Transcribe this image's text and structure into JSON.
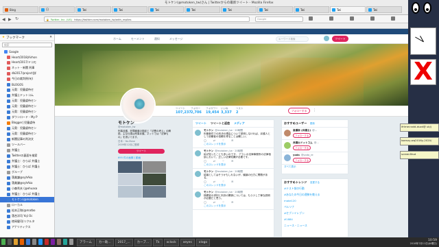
{
  "window": {
    "title": "モトケン(@motoken_tw)さん | Twitterからの最新ツイート - Mozilla Firefox"
  },
  "tabs": [
    {
      "label": "Bing"
    },
    {
      "label": "日"
    },
    {
      "label": "Twi"
    },
    {
      "label": "Twi"
    },
    {
      "label": "Twi"
    },
    {
      "label": "Twi"
    },
    {
      "label": "Twi"
    },
    {
      "label": "Twi"
    },
    {
      "label": "Twi"
    },
    {
      "label": "Twi"
    },
    {
      "label": "Twi"
    }
  ],
  "url": {
    "site": "Twitter, Inc. (US)",
    "address": "https://twitter.com/motoken_tw/with_replies",
    "search_placeholder": "Google"
  },
  "sidebar": {
    "title": "ブックマーク",
    "search_placeholder": "検索",
    "items": [
      {
        "label": "Google",
        "color": "#4285f4"
      },
      {
        "label": "Heart/2018|Airhon",
        "color": "#e05a5a"
      },
      {
        "label": "Heart/2017/ドコモ",
        "color": "#e05a5a"
      },
      {
        "label": "ネット・新聞 刑事",
        "color": "#e05a5a"
      },
      {
        "label": "db2017/project|詳",
        "color": "#e05a5a"
      },
      {
        "label": "今日の裁判例(旬)",
        "color": "#e05a5a"
      },
      {
        "label": "BLOGOS",
        "color": "#3a7bd5"
      },
      {
        "label": "元奥：児童虐待セ",
        "color": "#3a7bd5"
      },
      {
        "label": "弁護士ドットコム",
        "color": "#3a7bd5"
      },
      {
        "label": "元奥：児童虐待セン",
        "color": "#3a7bd5"
      },
      {
        "label": "元奥：児童虐待セン",
        "color": "#3a7bd5"
      },
      {
        "label": "元奥：児童虐待セン",
        "color": "#3a7bd5"
      },
      {
        "label": "ダウンロード・My P",
        "color": "#3a7bd5"
      },
      {
        "label": "Blogger| 児童虐待",
        "color": "#f57d00"
      },
      {
        "label": "元奥：児童虐待セン",
        "color": "#3a7bd5"
      },
      {
        "label": "元奥：児童虐待セン",
        "color": "#3a7bd5"
      },
      {
        "label": "新聞記事の判決文",
        "color": "#3a7bd5"
      },
      {
        "label": "ツールバー",
        "color": "#999999"
      },
      {
        "label": "弁護士",
        "color": "#999999"
      },
      {
        "label": "Twitterの裏面を検索",
        "color": "#3a7bd5"
      },
      {
        "label": "弁護士：ひらば 弁護士",
        "color": "#3a7bd5"
      },
      {
        "label": "弁護士：ひらば 弁護士",
        "color": "#3a7bd5"
      },
      {
        "label": "グループ",
        "color": "#999999"
      },
      {
        "label": "落美謙@syhAka",
        "color": "#3a7bd5"
      },
      {
        "label": "落美謙@syhAka",
        "color": "#3a7bd5"
      },
      {
        "label": "小森秀夫 (@ehuasa",
        "color": "#3a7bd5"
      },
      {
        "label": "弁護士：ひらば 弁護士",
        "color": "#3a7bd5"
      },
      {
        "label": "モトケン(@motoken",
        "color": "#3a7bd5"
      },
      {
        "label": "ローカル",
        "color": "#999999"
      },
      {
        "label": "松本正和(@matbo",
        "color": "#3a7bd5"
      },
      {
        "label": "落合洋司 Yoji Oc",
        "color": "#3a7bd5"
      },
      {
        "label": "徳岡健司(リクルタ",
        "color": "#3a7bd5"
      },
      {
        "label": "アナリティクス",
        "color": "#3a7bd5"
      }
    ],
    "selected_index": 27
  },
  "twitter": {
    "nav": [
      "ホーム",
      "モーメント",
      "通知",
      "メッセージ"
    ],
    "search_placeholder": "キーワード検索",
    "tweet_button": "ツイート",
    "stats": [
      {
        "label": "ツイート",
        "value": "107,237"
      },
      {
        "label": "フォロー",
        "value": "2,706"
      },
      {
        "label": "フォロワー",
        "value": "19,454"
      },
      {
        "label": "いいね",
        "value": "3,337"
      },
      {
        "label": "リスト",
        "value": "2"
      }
    ],
    "follow_button": "フォローする",
    "profile": {
      "name": "モトケン",
      "handle": "@motoken_tw",
      "bio": "刑事弁護、犯罪報道の検証と「法曹の考え」の解説。主な仕事は刑事弁護。ネットでは「法律もの」を書いてます。",
      "location": "日本・YouTube",
      "joined": "2009年12月に登録",
      "tweet_to": "ツイート",
      "media_label": "695 件の画像と動画"
    },
    "tabs": [
      "ツイート",
      "ツイートと返信",
      "メディア"
    ],
    "tweets": [
      {
        "name": "モトケン",
        "handle": "@motoken_tw · 20時間",
        "text": "刑事事件での判決の理由について説明しなければ、弁護人として依頼者の信頼を得ることは難しい。",
        "link": "このスレッドを表示"
      },
      {
        "name": "モトケン",
        "handle": "@motoken_tw · 20時間",
        "text": "私が知ったことも多いのです。 アランの法律事務所の法律相談において、正しい法律知識が必要です。",
        "link": "このスレッドを表示"
      },
      {
        "name": "モトケン",
        "handle": "@motoken_tw · 20時間",
        "text": "結論としてはそうかもしれないが、議論の仕方に問題がある。",
        "link": "このスレッドを表示"
      },
      {
        "name": "モトケン",
        "handle": "@motoken_tw · 20時間",
        "text": "検察官の求刑と判決の関係については、もう少し丁寧な説明が必要だと思う。",
        "link": "このスレッドを表示"
      }
    ],
    "who_to_follow": {
      "title": "おすすめユーザー",
      "refresh": "更新",
      "view_all": "すべて表示",
      "users": [
        {
          "name": "高瀬幸 (弁護士)",
          "handle": "@...",
          "action": "フォローする"
        },
        {
          "name": "弁護士ドットコム",
          "handle": "@...",
          "action": "フォローする"
        },
        {
          "name": "yoda",
          "handle": "@yoda_re",
          "action": "フォローする"
        }
      ]
    },
    "trends": {
      "title": "おすすめトレンド",
      "change": "変更する",
      "items": [
        "#テスト前の行動",
        "#あなたの今日の運勢を教える",
        "make120",
        "ペルソナ",
        "#セブンイレブン",
        "#1884",
        "ニュース・ニュース"
      ]
    }
  },
  "taskbar": {
    "items": [
      "アラーム",
      "カー助...",
      "2017_...",
      "カーブ...",
      "Tk",
      "xclock",
      "xeyes",
      "xlogo"
    ],
    "clock": "10:59",
    "date": "2018年7月11日(水曜日)"
  },
  "right_panel": {
    "stickies": [
      "ifrime>add-duzd@ uk/j",
      "koenzy-wq2016y-2020/",
      "screen5hot"
    ]
  }
}
